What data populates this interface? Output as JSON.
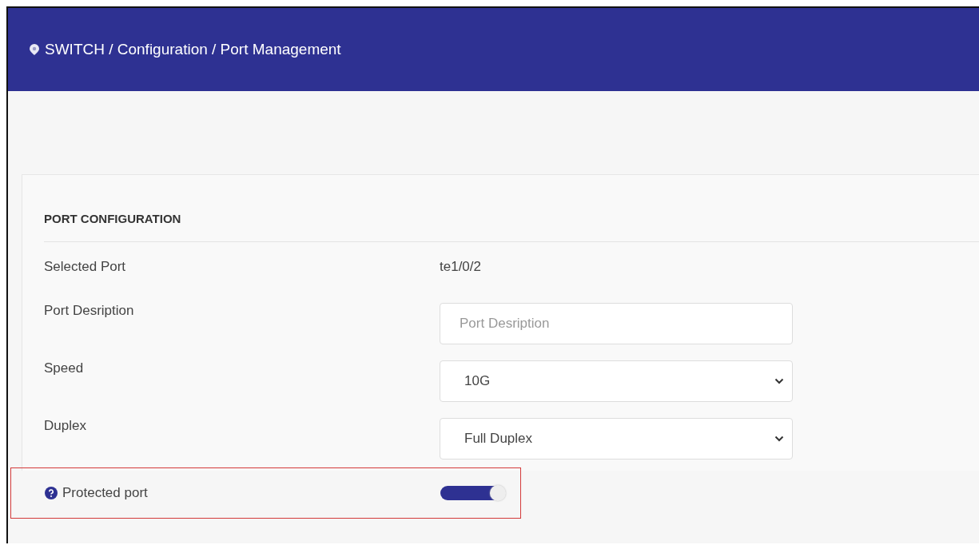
{
  "header": {
    "breadcrumb": "SWITCH / Configuration / Port Management"
  },
  "card": {
    "title": "PORT CONFIGURATION",
    "rows": [
      {
        "kind": "text",
        "label": "Selected Port",
        "value": "te1/0/2",
        "highlighted": false
      },
      {
        "kind": "input",
        "label": "Port Desription",
        "placeholder": "Port Desription",
        "highlighted": false
      },
      {
        "kind": "select",
        "label": "Speed",
        "value": "10G",
        "highlighted": false
      },
      {
        "kind": "select",
        "label": "Duplex",
        "value": "Full Duplex",
        "highlighted": false
      },
      {
        "kind": "toggle",
        "label": "Protected port",
        "help": true,
        "on": true,
        "highlighted": true
      }
    ]
  }
}
